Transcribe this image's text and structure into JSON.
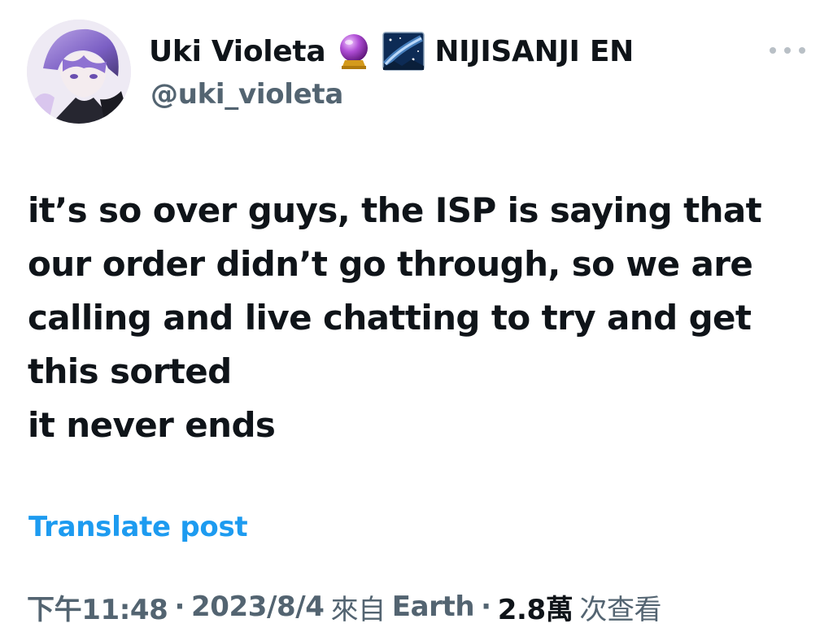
{
  "author": {
    "display_name": "Uki Violeta",
    "name_suffix": "NIJISANJI EN",
    "handle": "@uki_violeta",
    "emoji_1": "crystal-ball-icon",
    "emoji_2": "milky-way-icon"
  },
  "tweet": {
    "lines": [
      "it’s so over guys, the ISP is saying that",
      "our order didn’t go through, so we are",
      "calling and live chatting to try and get",
      "this sorted",
      "it never ends"
    ]
  },
  "translate_label": "Translate post",
  "meta": {
    "time": "下午11:48",
    "separator": "·",
    "date": "2023/8/4",
    "source_prefix": "來自",
    "source": "Earth",
    "views_count": "2.8萬",
    "views_label": "次查看"
  },
  "colors": {
    "link": "#1d9bf0",
    "secondary_text": "#536471",
    "primary_text": "#0f1419"
  }
}
